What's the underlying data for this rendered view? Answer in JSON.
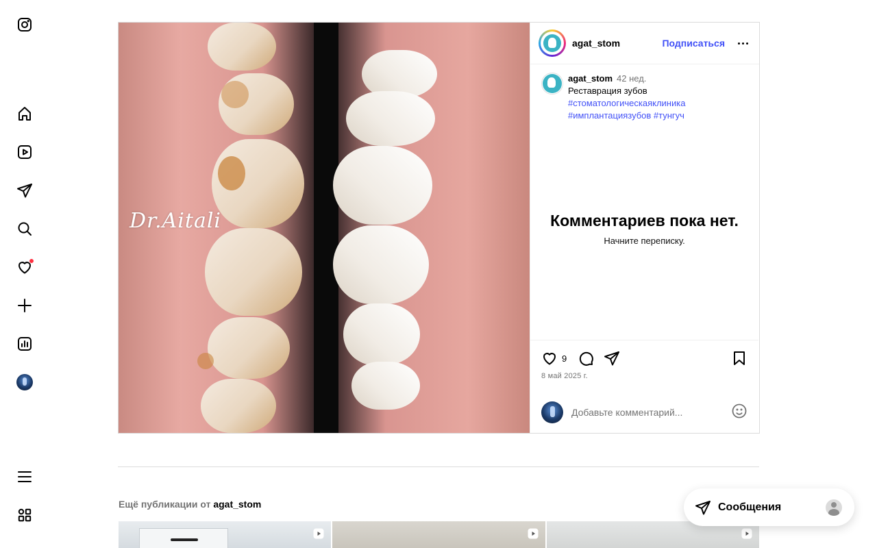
{
  "nav": {
    "items": [
      {
        "icon": "instagram-logo-icon"
      },
      {
        "icon": "home-icon"
      },
      {
        "icon": "reels-icon"
      },
      {
        "icon": "direct-icon"
      },
      {
        "icon": "search-icon"
      },
      {
        "icon": "notifications-heart-icon",
        "has_dot": true
      },
      {
        "icon": "create-plus-icon"
      },
      {
        "icon": "dashboard-icon"
      },
      {
        "icon": "profile-avatar"
      },
      {
        "icon": "menu-icon"
      },
      {
        "icon": "also-from-meta-icon"
      }
    ]
  },
  "post": {
    "media": {
      "watermark": "Dr.Aitali"
    },
    "header": {
      "username": "agat_stom",
      "follow_label": "Подписаться"
    },
    "caption": {
      "username": "agat_stom",
      "time_ago": "42 нед.",
      "text": "Реставрация зубов",
      "hashtags": [
        "#стоматологическаяклиника",
        "#имплантациязубов",
        "#тунгуч"
      ]
    },
    "empty_comments": {
      "title": "Комментариев пока нет.",
      "subtitle": "Начните переписку."
    },
    "likes_count": "9",
    "date": "8 май 2025 г.",
    "comment_placeholder": "Добавьте комментарий..."
  },
  "more_posts": {
    "prefix": "Ещё публикации от",
    "username": "agat_stom",
    "thumbs": [
      {
        "type": "reel"
      },
      {
        "type": "reel"
      },
      {
        "type": "reel"
      }
    ]
  },
  "messages": {
    "label": "Сообщения"
  },
  "colors": {
    "accent": "#4150f7",
    "notification": "#ff3040",
    "secondary_text": "#737373",
    "border": "#dbdbdb"
  }
}
